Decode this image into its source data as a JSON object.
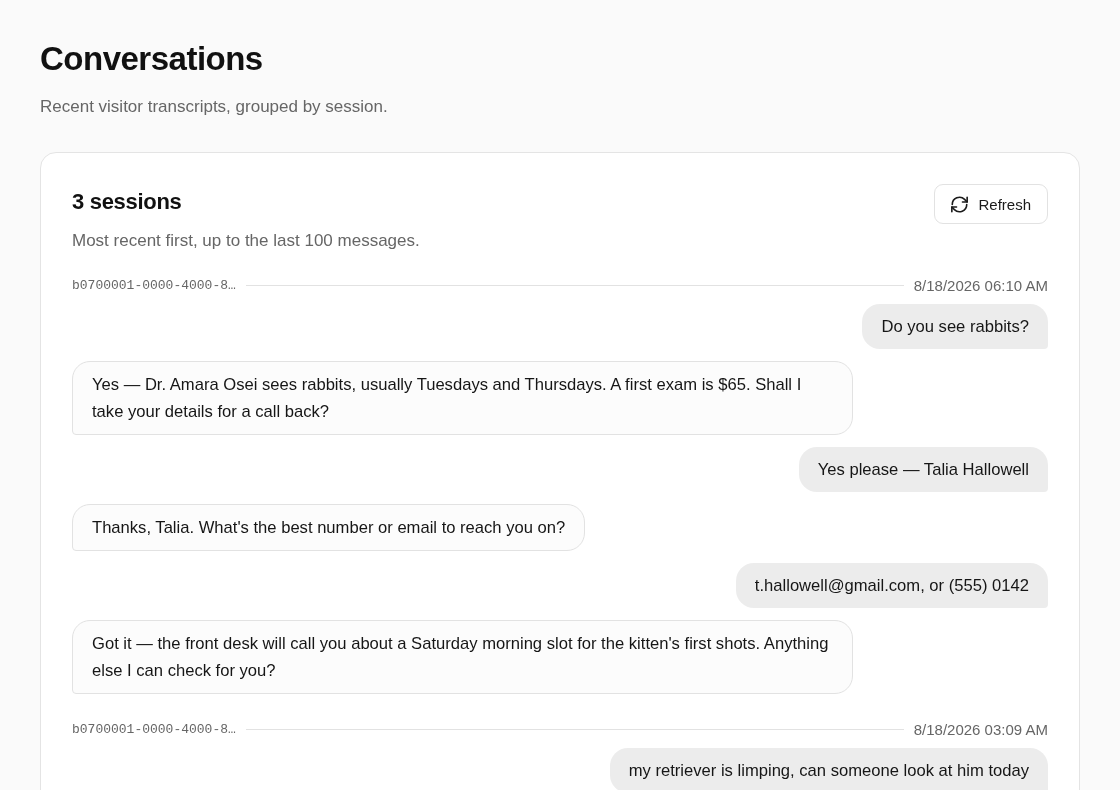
{
  "page": {
    "title": "Conversations",
    "subtitle": "Recent visitor transcripts, grouped by session."
  },
  "card": {
    "title": "3 sessions",
    "subtitle": "Most recent first, up to the last 100 messages.",
    "refresh_button": {
      "label": "Refresh"
    }
  },
  "sessions": [
    {
      "id": "b0700001-0000-4000-8…",
      "timestamp": "8/18/2026 06:10 AM",
      "messages": [
        {
          "kind": "visitor",
          "text": "Do you see rabbits?"
        },
        {
          "kind": "assistant",
          "text": "Yes — Dr. Amara Osei sees rabbits, usually Tuesdays and Thursdays. A first exam is $65. Shall I take your details for a call back?"
        },
        {
          "kind": "visitor",
          "text": "Yes please — Talia Hallowell"
        },
        {
          "kind": "assistant",
          "text": "Thanks, Talia. What's the best number or email to reach you on?"
        },
        {
          "kind": "visitor",
          "text": "t.hallowell@gmail.com, or (555) 0142"
        },
        {
          "kind": "assistant",
          "text": "Got it — the front desk will call you about a Saturday morning slot for the kitten's first shots. Anything else I can check for you?"
        }
      ]
    },
    {
      "id": "b0700001-0000-4000-8…",
      "timestamp": "8/18/2026 03:09 AM",
      "messages": [
        {
          "kind": "visitor",
          "text": "my retriever is limping, can someone look at him today"
        }
      ]
    }
  ]
}
